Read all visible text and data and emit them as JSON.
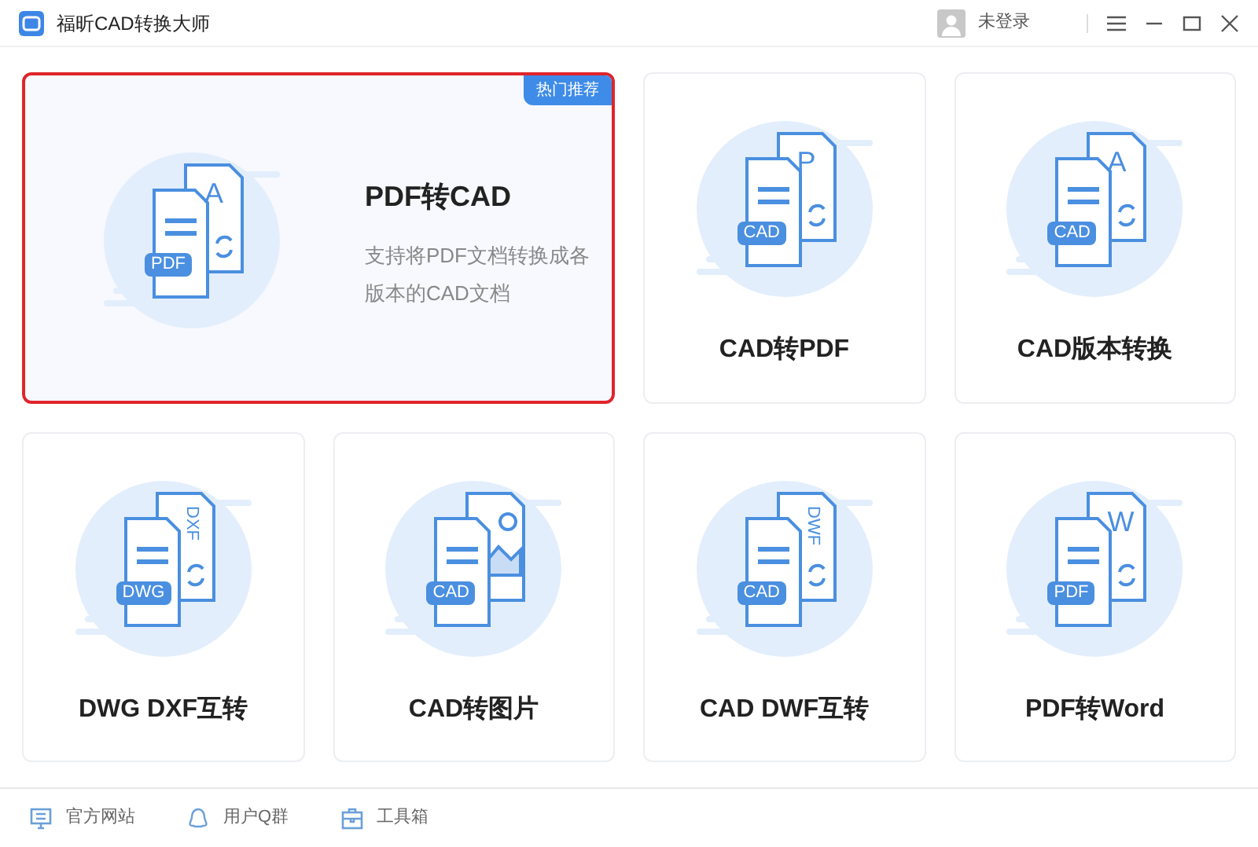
{
  "window": {
    "title": "福昕CAD转换大师",
    "user": "未登录"
  },
  "cards": [
    {
      "kind": "wide",
      "title": "PDF转CAD",
      "description": "支持将PDF文档转换成各版本的CAD文档",
      "tag": "热门推荐",
      "selected": true,
      "badge": "PDF",
      "overlay": {
        "kind": "letter",
        "text": "A"
      }
    },
    {
      "kind": "tile",
      "title": "CAD转PDF",
      "selected": false,
      "badge": "CAD",
      "overlay": {
        "kind": "letter",
        "text": "P"
      }
    },
    {
      "kind": "tile",
      "title": "CAD版本转换",
      "selected": false,
      "badge": "CAD",
      "overlay": {
        "kind": "letter",
        "text": "A"
      }
    },
    {
      "kind": "tile",
      "title": "DWG DXF互转",
      "selected": false,
      "badge": "DWG",
      "overlay": {
        "kind": "vertical",
        "text": "DXF"
      }
    },
    {
      "kind": "tile",
      "title": "CAD转图片",
      "selected": false,
      "badge": "CAD",
      "overlay": {
        "kind": "image"
      }
    },
    {
      "kind": "tile",
      "title": "CAD DWF互转",
      "selected": false,
      "badge": "CAD",
      "overlay": {
        "kind": "vertical",
        "text": "DWF"
      }
    },
    {
      "kind": "tile",
      "title": "PDF转Word",
      "selected": false,
      "badge": "PDF",
      "overlay": {
        "kind": "letter",
        "text": "W"
      }
    }
  ],
  "footer": [
    {
      "kind": "website",
      "label": "官方网站"
    },
    {
      "kind": "group",
      "label": "用户Q群"
    },
    {
      "kind": "toolbox",
      "label": "工具箱"
    }
  ]
}
